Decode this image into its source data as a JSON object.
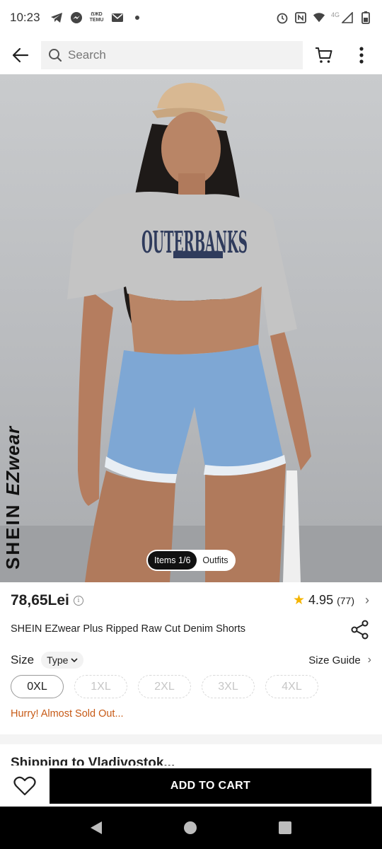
{
  "status_bar": {
    "time": "10:23",
    "network_label": "4G",
    "temu_label": "ẞЖD TEMU"
  },
  "app_bar": {
    "search_placeholder": "Search",
    "icons": [
      "back-arrow-icon",
      "search-icon",
      "cart-icon",
      "more-vert-icon"
    ]
  },
  "hero": {
    "brand_prefix": "SHEIN ",
    "brand_ez": "EZwear",
    "pill_items": "Items 1/6",
    "pill_outfits": "Outfits"
  },
  "product": {
    "price": "78,65Lei",
    "rating": "4.95",
    "rating_count": "(77)",
    "title": "SHEIN EZwear Plus Ripped Raw Cut Denim Shorts",
    "size_label": "Size",
    "type_label": "Type",
    "size_guide_label": "Size Guide",
    "sizes": [
      {
        "label": "0XL",
        "available": true
      },
      {
        "label": "1XL",
        "available": false
      },
      {
        "label": "2XL",
        "available": false
      },
      {
        "label": "3XL",
        "available": false
      },
      {
        "label": "4XL",
        "available": false
      }
    ],
    "hurry_text": "Hurry! Almost Sold Out..."
  },
  "peek_section": {
    "text": "Shipping to Vladivostok..."
  },
  "bottom_bar": {
    "add_to_cart_label": "ADD TO CART"
  },
  "colors": {
    "accent_text": "#c75a16",
    "star": "#f5b400",
    "cta_bg": "#000000"
  }
}
